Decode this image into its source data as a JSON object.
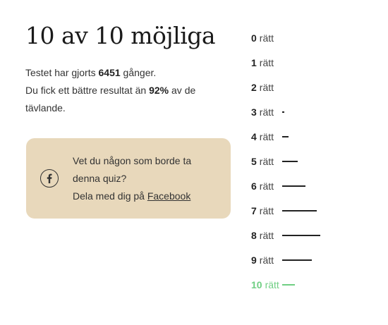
{
  "result": {
    "title": "10 av 10 möjliga",
    "stats_prefix": "Testet har gjorts ",
    "times_taken": "6451",
    "stats_suffix": " gånger.",
    "better_prefix": "Du fick ett bättre resultat än ",
    "better_percent": "92%",
    "better_suffix": " av de tävlande."
  },
  "share": {
    "icon": "facebook-icon",
    "line1": "Vet du någon som borde ta denna quiz?",
    "line2_prefix": "Dela med dig på ",
    "link_label": "Facebook",
    "background_color": "#e8d8bb"
  },
  "distribution": {
    "unit_label": "rätt",
    "current_score": 10,
    "highlight_color": "#6fcf83",
    "rows": [
      {
        "score": "0",
        "share": 0.0
      },
      {
        "score": "1",
        "share": 0.0
      },
      {
        "score": "2",
        "share": 0.0
      },
      {
        "score": "3",
        "share": 0.05
      },
      {
        "score": "4",
        "share": 0.17
      },
      {
        "score": "5",
        "share": 0.4
      },
      {
        "score": "6",
        "share": 0.62
      },
      {
        "score": "7",
        "share": 0.91
      },
      {
        "score": "8",
        "share": 1.0
      },
      {
        "score": "9",
        "share": 0.78
      },
      {
        "score": "10",
        "share": 0.33
      }
    ]
  }
}
